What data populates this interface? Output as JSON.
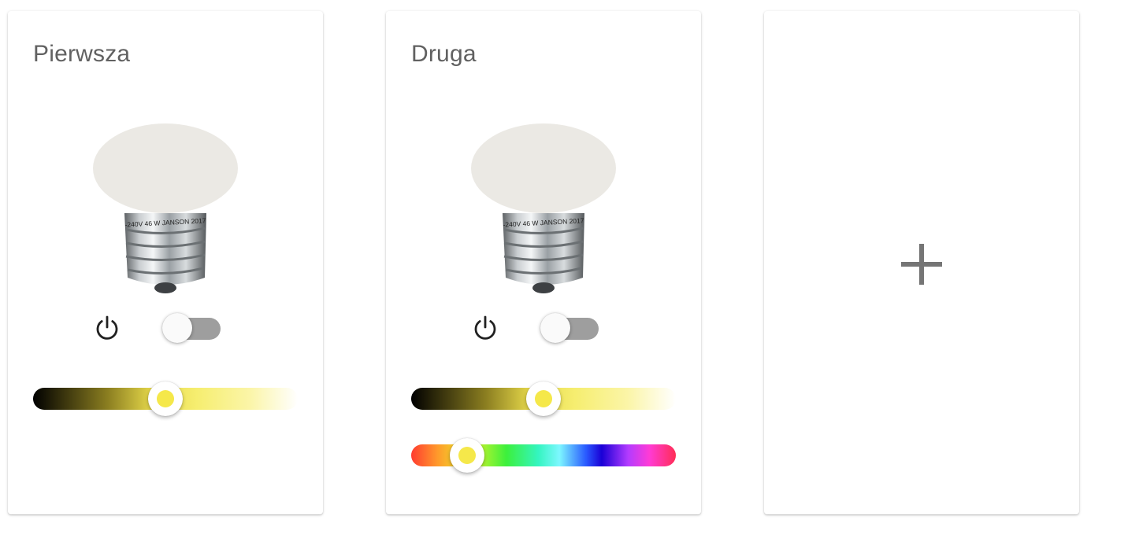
{
  "cards": [
    {
      "title": "Pierwsza",
      "bulb_label": "-240V 46 W JANSON 2017",
      "power_on": false,
      "brightness": 0.5,
      "has_color_slider": false
    },
    {
      "title": "Druga",
      "bulb_label": "-240V 46 W JANSON 2017",
      "power_on": false,
      "brightness": 0.5,
      "hue": 0.21,
      "has_color_slider": true
    }
  ],
  "add_card": {
    "icon": "plus-icon"
  },
  "colors": {
    "bulb_glass": "#ebe9e4",
    "toggle_off_track": "#9e9e9e",
    "thumb_accent": "#f5e84a",
    "title_text": "#616161"
  }
}
